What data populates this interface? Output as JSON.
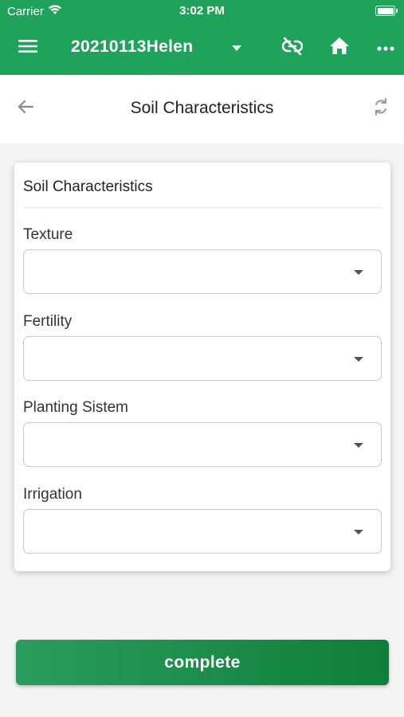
{
  "status_bar": {
    "carrier": "Carrier",
    "time": "3:02 PM",
    "icons": [
      "wifi-icon",
      "battery-icon"
    ]
  },
  "app_bar": {
    "title": "20210113Helen",
    "icons": [
      "menu-icon",
      "dropdown-caret-icon",
      "link-off-icon",
      "home-icon",
      "more-horizontal-icon"
    ],
    "background_color": "#1fa25a"
  },
  "sub_header": {
    "title": "Soil Characteristics",
    "icons": [
      "back-arrow-icon",
      "sync-icon"
    ]
  },
  "card": {
    "header": "Soil Characteristics",
    "fields": [
      {
        "label": "Texture",
        "value": ""
      },
      {
        "label": "Fertility",
        "value": ""
      },
      {
        "label": "Planting Sistem",
        "value": ""
      },
      {
        "label": "Irrigation",
        "value": ""
      }
    ]
  },
  "actions": {
    "complete_label": "complete",
    "button_color": "#1a8e4a"
  }
}
